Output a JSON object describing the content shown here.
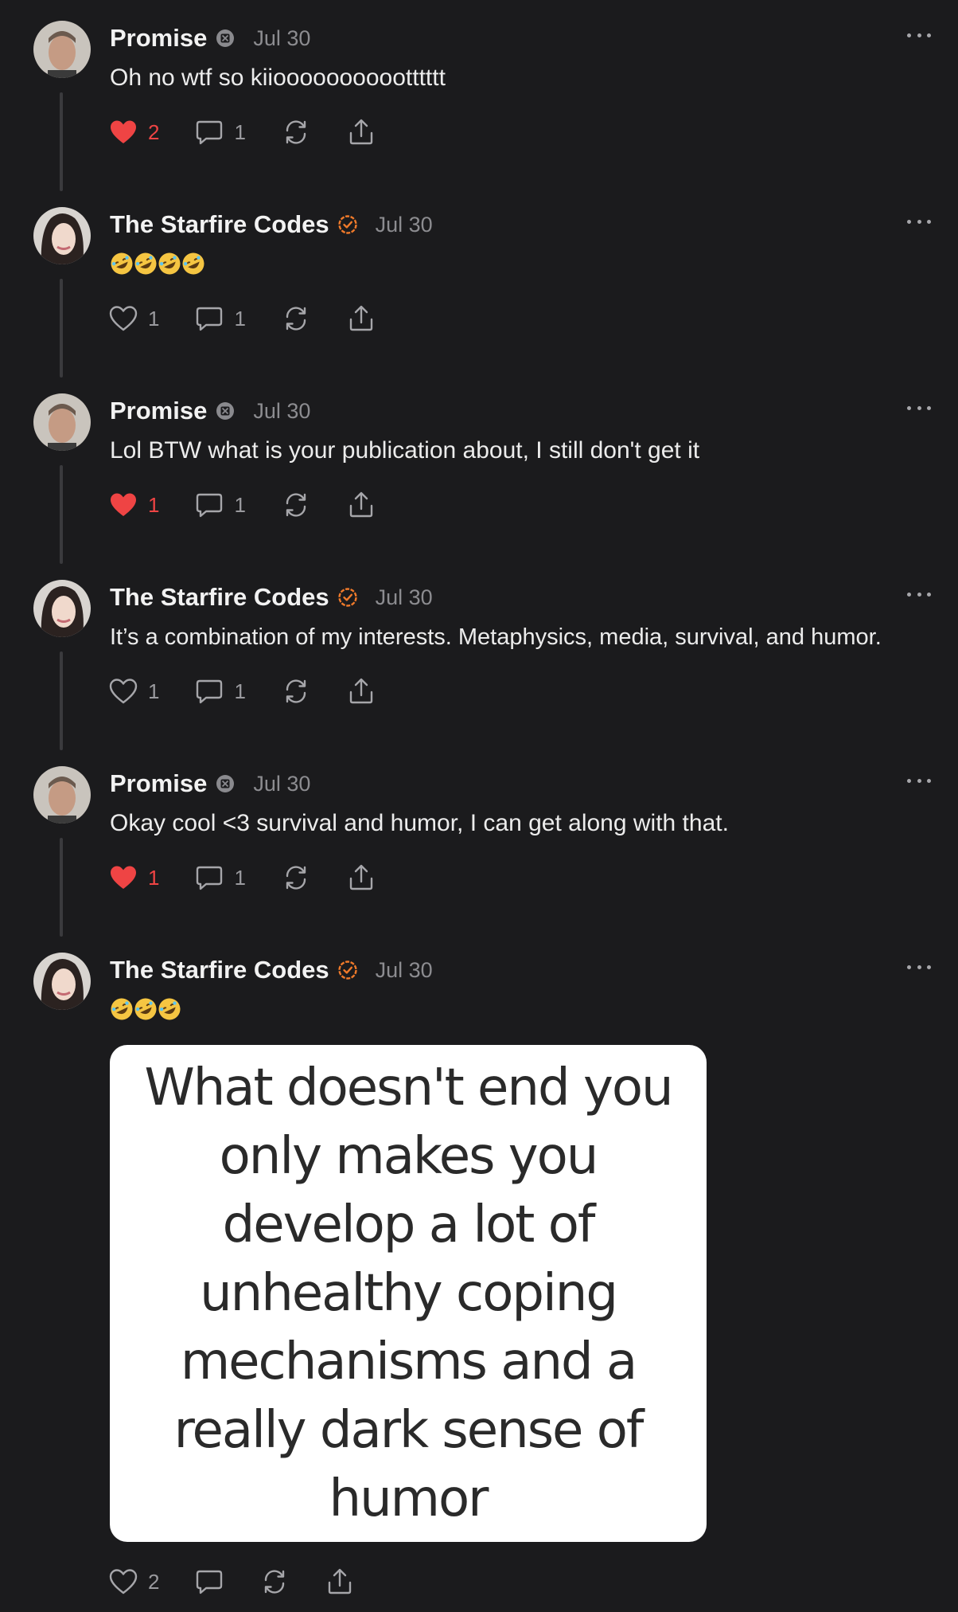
{
  "comments": [
    {
      "author": "Promise",
      "badge": "subscriber-badge-icon",
      "date": "Jul 30",
      "text": "Oh no wtf so kiiooooooooootttttt",
      "likes": "2",
      "liked": true,
      "replies": "1"
    },
    {
      "author": "The Starfire Codes",
      "badge": "verified-badge-icon",
      "date": "Jul 30",
      "emoji_count": 4,
      "likes": "1",
      "liked": false,
      "replies": "1"
    },
    {
      "author": "Promise",
      "badge": "subscriber-badge-icon",
      "date": "Jul 30",
      "text": "Lol BTW what is your publication about, I still don't get it",
      "likes": "1",
      "liked": true,
      "replies": "1"
    },
    {
      "author": "The Starfire Codes",
      "badge": "verified-badge-icon",
      "date": "Jul 30",
      "text": "It’s a combination of my interests. Metaphysics, media, survival, and humor.",
      "likes": "1",
      "liked": false,
      "replies": "1"
    },
    {
      "author": "Promise",
      "badge": "subscriber-badge-icon",
      "date": "Jul 30",
      "text": "Okay cool <3 survival and humor, I can get along with that.",
      "likes": "1",
      "liked": true,
      "replies": "1"
    },
    {
      "author": "The Starfire Codes",
      "badge": "verified-badge-icon",
      "date": "Jul 30",
      "emoji_count": 3,
      "image_text": "What doesn't end you only makes you develop a lot of unhealthy coping mechanisms and a really dark sense of humor",
      "likes": "2",
      "liked": false,
      "replies": ""
    }
  ],
  "colors": {
    "background": "#1b1b1d",
    "like_active": "#ef4444",
    "verified_orange": "#f07a2a",
    "muted_text": "#8c8c90"
  }
}
